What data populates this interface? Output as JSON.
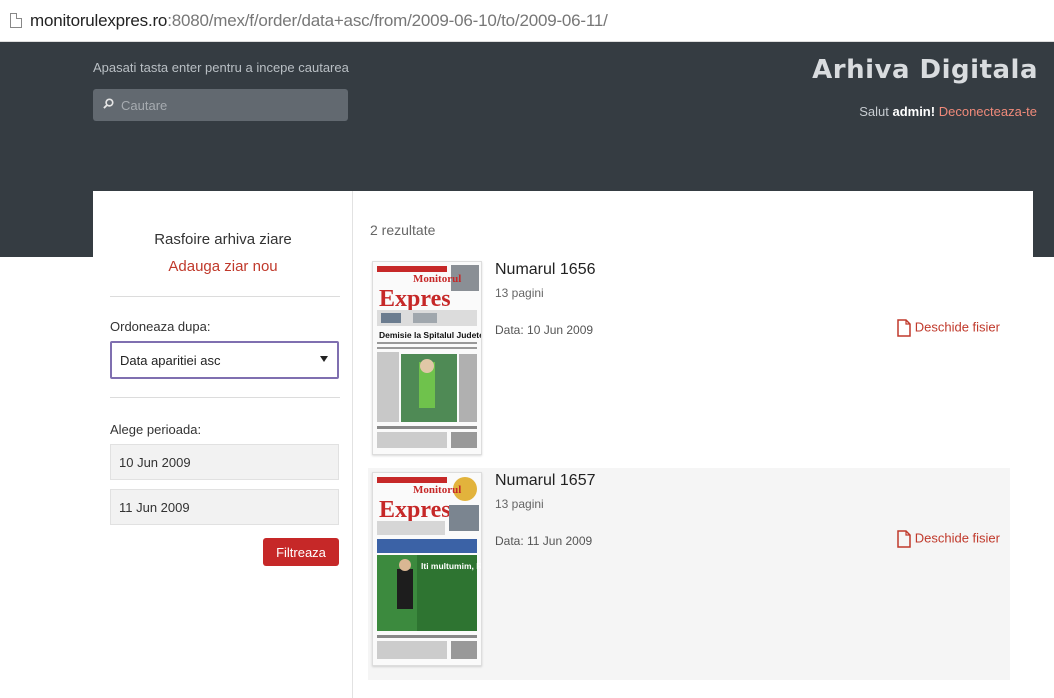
{
  "browser": {
    "url_host": "monitorulexpres.ro",
    "url_rest": ":8080/mex/f/order/data+asc/from/2009-06-10/to/2009-06-11/"
  },
  "header": {
    "hint": "Apasati tasta enter pentru a incepe cautarea",
    "search_placeholder": "Cautare",
    "brand": "Arhiva Digitala",
    "greeting_prefix": "Salut ",
    "username": "admin!",
    "logout": "Deconecteaza-te"
  },
  "sidebar": {
    "title": "Rasfoire arhiva ziare",
    "add_link": "Adauga ziar nou",
    "order_label": "Ordoneaza dupa:",
    "order_value": "Data aparitiei asc",
    "period_label": "Alege perioada:",
    "date_from": "10 Jun 2009",
    "date_to": "11 Jun 2009",
    "filter_button": "Filtreaza"
  },
  "results": {
    "count": "2 rezultate",
    "items": [
      {
        "title": "Numarul 1656",
        "pages": "13 pagini",
        "date": "Data: 10 Jun 2009",
        "open": "Deschide fisier",
        "thumb": {
          "header_text": "Monitorul",
          "brand_text": "Expres",
          "headline": "Demisie la Spitalul Judetean"
        }
      },
      {
        "title": "Numarul 1657",
        "pages": "13 pagini",
        "date": "Data: 11 Jun 2009",
        "open": "Deschide fisier",
        "thumb": {
          "header_text": "Monitorul",
          "brand_text": "Expres",
          "headline": "Iti multumim, Razvan!"
        }
      }
    ]
  },
  "colors": {
    "header_bg": "#353c42",
    "accent_red": "#c62828",
    "link_red": "#c0392b",
    "select_border": "#7f6fb0"
  }
}
